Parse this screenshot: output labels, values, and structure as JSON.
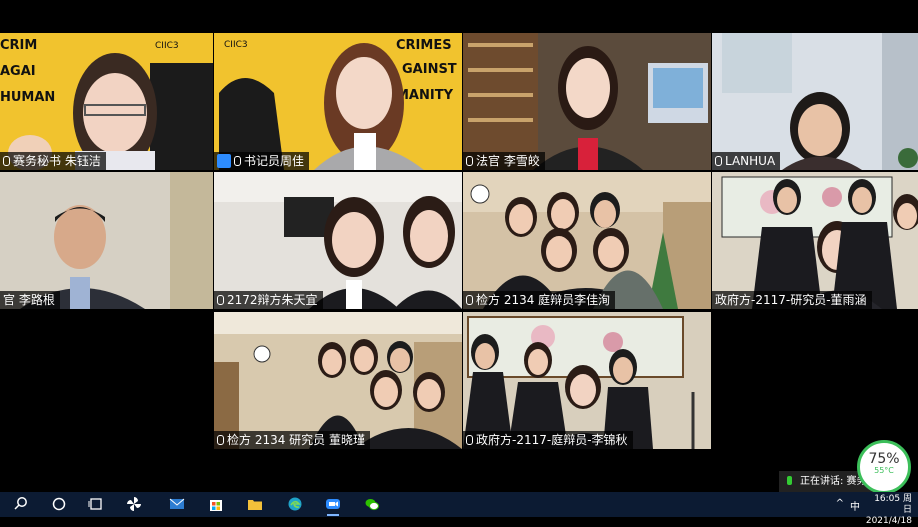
{
  "tiles": [
    {
      "label": "赛务秘书 朱钰洁",
      "mic": "on"
    },
    {
      "label": "书记员周佳",
      "mic": "on",
      "avatar": true
    },
    {
      "label": "法官 李雪皎",
      "mic": "on"
    },
    {
      "label": "LANHUA",
      "mic": "on"
    },
    {
      "label": "官 李路根",
      "mic": "none"
    },
    {
      "label": "2172辩方朱天宜",
      "mic": "on"
    },
    {
      "label": "检方 2134 庭辩员李佳洵",
      "mic": "on"
    },
    {
      "label": "政府方-2117-研究员-董雨涵",
      "mic": "none"
    },
    {
      "label": "检方 2134 研究员 董晓瑾",
      "mic": "on"
    },
    {
      "label": "政府方-2117-庭辩员-李锦秋",
      "mic": "on"
    }
  ],
  "poster_text": {
    "left": [
      "CRIM",
      "AGAI",
      "HUMAN"
    ],
    "right": [
      "CRIMES",
      "GAINST",
      "MANITY"
    ],
    "logo": "CIIC3"
  },
  "speaking": {
    "text": "正在讲话: 赛务 朱钰洁"
  },
  "perf_gauge": {
    "percent": "75%",
    "temp": "55°C"
  },
  "clock": {
    "time": "16:05 周日",
    "date": "2021/4/18"
  },
  "tray": {
    "chevron": "^",
    "ime": "中"
  },
  "taskbar_icons": [
    "search-icon",
    "cortana-icon",
    "task-view-icon",
    "pinwheel-icon",
    "mail-icon",
    "store-icon",
    "explorer-icon",
    "edge-icon",
    "zoom-meetings-icon",
    "wechat-icon"
  ]
}
